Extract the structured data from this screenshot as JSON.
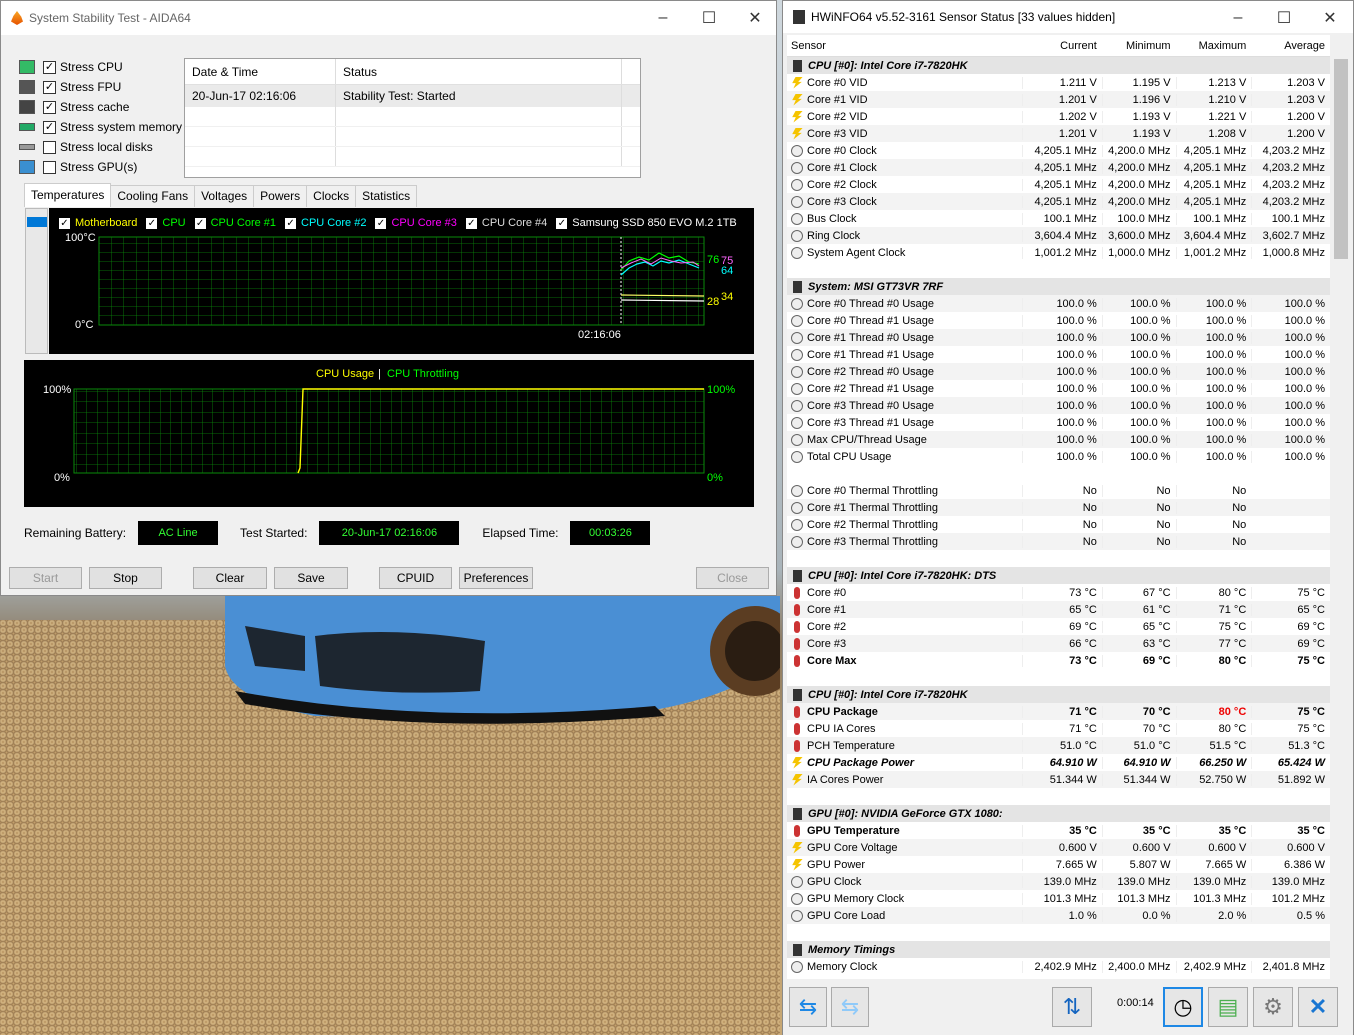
{
  "aida": {
    "title": "System Stability Test - AIDA64",
    "stress": [
      {
        "label": "Stress CPU",
        "checked": true,
        "icon": "cpu-chip-icon"
      },
      {
        "label": "Stress FPU",
        "checked": true,
        "icon": "fpu-icon"
      },
      {
        "label": "Stress cache",
        "checked": true,
        "icon": "cache-icon"
      },
      {
        "label": "Stress system memory",
        "checked": true,
        "icon": "memory-icon"
      },
      {
        "label": "Stress local disks",
        "checked": false,
        "icon": "disk-icon"
      },
      {
        "label": "Stress GPU(s)",
        "checked": false,
        "icon": "monitor-icon"
      }
    ],
    "log": {
      "col1": "Date & Time",
      "col2": "Status",
      "rows": [
        {
          "time": "20-Jun-17 02:16:06",
          "status": "Stability Test: Started"
        }
      ]
    },
    "tabs": [
      "Temperatures",
      "Cooling Fans",
      "Voltages",
      "Powers",
      "Clocks",
      "Statistics"
    ],
    "temp_legend": [
      {
        "label": "Motherboard",
        "color": "#ffff00"
      },
      {
        "label": "CPU",
        "color": "#00ff00"
      },
      {
        "label": "CPU Core #1",
        "color": "#00ff00"
      },
      {
        "label": "CPU Core #2",
        "color": "#00ffff"
      },
      {
        "label": "CPU Core #3",
        "color": "#ff00ff"
      },
      {
        "label": "CPU Core #4",
        "color": "#dddddd"
      },
      {
        "label": "Samsung SSD 850 EVO M.2 1TB",
        "color": "#ffffff"
      }
    ],
    "temp_graph": {
      "ymax": "100°C",
      "ymin": "0°C",
      "time": "02:16:06",
      "v76": "76",
      "v75": "75",
      "v64": "64",
      "v34": "34",
      "v28": "28"
    },
    "usage_graph": {
      "title_usage": "CPU Usage",
      "sep": "|",
      "title_throttle": "CPU Throttling",
      "left_top": "100%",
      "left_bottom": "0%",
      "right_top": "100%",
      "right_bottom": "0%"
    },
    "status": {
      "battery_label": "Remaining Battery:",
      "battery": "AC Line",
      "started_label": "Test Started:",
      "started": "20-Jun-17 02:16:06",
      "elapsed_label": "Elapsed Time:",
      "elapsed": "00:03:26"
    },
    "buttons": {
      "start": "Start",
      "stop": "Stop",
      "clear": "Clear",
      "save": "Save",
      "cpuid": "CPUID",
      "preferences": "Preferences",
      "close": "Close"
    }
  },
  "hwinfo": {
    "title": "HWiNFO64 v5.52-3161 Sensor Status [33 values hidden]",
    "columns": [
      "Sensor",
      "Current",
      "Minimum",
      "Maximum",
      "Average"
    ],
    "rows": [
      {
        "t": "sec",
        "n": "CPU [#0]: Intel Core i7-7820HK"
      },
      {
        "i": "volt",
        "n": "Core #0 VID",
        "v": [
          "1.211 V",
          "1.195 V",
          "1.213 V",
          "1.203 V"
        ]
      },
      {
        "i": "volt",
        "n": "Core #1 VID",
        "v": [
          "1.201 V",
          "1.196 V",
          "1.210 V",
          "1.203 V"
        ]
      },
      {
        "i": "volt",
        "n": "Core #2 VID",
        "v": [
          "1.202 V",
          "1.193 V",
          "1.221 V",
          "1.200 V"
        ]
      },
      {
        "i": "volt",
        "n": "Core #3 VID",
        "v": [
          "1.201 V",
          "1.193 V",
          "1.208 V",
          "1.200 V"
        ]
      },
      {
        "i": "clk",
        "n": "Core #0 Clock",
        "v": [
          "4,205.1 MHz",
          "4,200.0 MHz",
          "4,205.1 MHz",
          "4,203.2 MHz"
        ]
      },
      {
        "i": "clk",
        "n": "Core #1 Clock",
        "v": [
          "4,205.1 MHz",
          "4,200.0 MHz",
          "4,205.1 MHz",
          "4,203.2 MHz"
        ]
      },
      {
        "i": "clk",
        "n": "Core #2 Clock",
        "v": [
          "4,205.1 MHz",
          "4,200.0 MHz",
          "4,205.1 MHz",
          "4,203.2 MHz"
        ]
      },
      {
        "i": "clk",
        "n": "Core #3 Clock",
        "v": [
          "4,205.1 MHz",
          "4,200.0 MHz",
          "4,205.1 MHz",
          "4,203.2 MHz"
        ]
      },
      {
        "i": "clk",
        "n": "Bus Clock",
        "v": [
          "100.1 MHz",
          "100.0 MHz",
          "100.1 MHz",
          "100.1 MHz"
        ]
      },
      {
        "i": "clk",
        "n": "Ring Clock",
        "v": [
          "3,604.4 MHz",
          "3,600.0 MHz",
          "3,604.4 MHz",
          "3,602.7 MHz"
        ]
      },
      {
        "i": "clk",
        "n": "System Agent Clock",
        "v": [
          "1,001.2 MHz",
          "1,000.0 MHz",
          "1,001.2 MHz",
          "1,000.8 MHz"
        ]
      },
      {
        "t": "blank"
      },
      {
        "t": "sec",
        "n": "System: MSI GT73VR 7RF"
      },
      {
        "i": "clk",
        "n": "Core #0 Thread #0 Usage",
        "v": [
          "100.0 %",
          "100.0 %",
          "100.0 %",
          "100.0 %"
        ]
      },
      {
        "i": "clk",
        "n": "Core #0 Thread #1 Usage",
        "v": [
          "100.0 %",
          "100.0 %",
          "100.0 %",
          "100.0 %"
        ]
      },
      {
        "i": "clk",
        "n": "Core #1 Thread #0 Usage",
        "v": [
          "100.0 %",
          "100.0 %",
          "100.0 %",
          "100.0 %"
        ]
      },
      {
        "i": "clk",
        "n": "Core #1 Thread #1 Usage",
        "v": [
          "100.0 %",
          "100.0 %",
          "100.0 %",
          "100.0 %"
        ]
      },
      {
        "i": "clk",
        "n": "Core #2 Thread #0 Usage",
        "v": [
          "100.0 %",
          "100.0 %",
          "100.0 %",
          "100.0 %"
        ]
      },
      {
        "i": "clk",
        "n": "Core #2 Thread #1 Usage",
        "v": [
          "100.0 %",
          "100.0 %",
          "100.0 %",
          "100.0 %"
        ]
      },
      {
        "i": "clk",
        "n": "Core #3 Thread #0 Usage",
        "v": [
          "100.0 %",
          "100.0 %",
          "100.0 %",
          "100.0 %"
        ]
      },
      {
        "i": "clk",
        "n": "Core #3 Thread #1 Usage",
        "v": [
          "100.0 %",
          "100.0 %",
          "100.0 %",
          "100.0 %"
        ]
      },
      {
        "i": "clk",
        "n": "Max CPU/Thread Usage",
        "v": [
          "100.0 %",
          "100.0 %",
          "100.0 %",
          "100.0 %"
        ]
      },
      {
        "i": "clk",
        "n": "Total CPU Usage",
        "v": [
          "100.0 %",
          "100.0 %",
          "100.0 %",
          "100.0 %"
        ]
      },
      {
        "t": "blank"
      },
      {
        "i": "clk",
        "n": "Core #0 Thermal Throttling",
        "v": [
          "No",
          "No",
          "No",
          ""
        ]
      },
      {
        "i": "clk",
        "n": "Core #1 Thermal Throttling",
        "v": [
          "No",
          "No",
          "No",
          ""
        ]
      },
      {
        "i": "clk",
        "n": "Core #2 Thermal Throttling",
        "v": [
          "No",
          "No",
          "No",
          ""
        ]
      },
      {
        "i": "clk",
        "n": "Core #3 Thermal Throttling",
        "v": [
          "No",
          "No",
          "No",
          ""
        ]
      },
      {
        "t": "blank"
      },
      {
        "t": "sec",
        "n": "CPU [#0]: Intel Core i7-7820HK: DTS"
      },
      {
        "i": "therm",
        "n": "Core #0",
        "v": [
          "73 °C",
          "67 °C",
          "80 °C",
          "75 °C"
        ]
      },
      {
        "i": "therm",
        "n": "Core #1",
        "v": [
          "65 °C",
          "61 °C",
          "71 °C",
          "65 °C"
        ]
      },
      {
        "i": "therm",
        "n": "Core #2",
        "v": [
          "69 °C",
          "65 °C",
          "75 °C",
          "69 °C"
        ]
      },
      {
        "i": "therm",
        "n": "Core #3",
        "v": [
          "66 °C",
          "63 °C",
          "77 °C",
          "69 °C"
        ]
      },
      {
        "i": "therm",
        "n": "Core Max",
        "v": [
          "73 °C",
          "69 °C",
          "80 °C",
          "75 °C"
        ],
        "s": "bold"
      },
      {
        "t": "blank"
      },
      {
        "t": "sec",
        "n": "CPU [#0]: Intel Core i7-7820HK"
      },
      {
        "i": "therm",
        "n": "CPU Package",
        "v": [
          "71 °C",
          "70 °C",
          "80 °C",
          "75 °C"
        ],
        "s": "bold",
        "red": 2
      },
      {
        "i": "therm",
        "n": "CPU IA Cores",
        "v": [
          "71 °C",
          "70 °C",
          "80 °C",
          "75 °C"
        ]
      },
      {
        "i": "therm",
        "n": "PCH Temperature",
        "v": [
          "51.0 °C",
          "51.0 °C",
          "51.5 °C",
          "51.3 °C"
        ]
      },
      {
        "i": "volt",
        "n": "CPU Package Power",
        "v": [
          "64.910 W",
          "64.910 W",
          "66.250 W",
          "65.424 W"
        ],
        "s": "it"
      },
      {
        "i": "volt",
        "n": "IA Cores Power",
        "v": [
          "51.344 W",
          "51.344 W",
          "52.750 W",
          "51.892 W"
        ]
      },
      {
        "t": "blank"
      },
      {
        "t": "sec",
        "n": "GPU [#0]: NVIDIA GeForce GTX 1080:"
      },
      {
        "i": "therm",
        "n": "GPU Temperature",
        "v": [
          "35 °C",
          "35 °C",
          "35 °C",
          "35 °C"
        ],
        "s": "bold"
      },
      {
        "i": "volt",
        "n": "GPU Core Voltage",
        "v": [
          "0.600 V",
          "0.600 V",
          "0.600 V",
          "0.600 V"
        ]
      },
      {
        "i": "volt",
        "n": "GPU Power",
        "v": [
          "7.665 W",
          "5.807 W",
          "7.665 W",
          "6.386 W"
        ]
      },
      {
        "i": "clk",
        "n": "GPU Clock",
        "v": [
          "139.0 MHz",
          "139.0 MHz",
          "139.0 MHz",
          "139.0 MHz"
        ]
      },
      {
        "i": "clk",
        "n": "GPU Memory Clock",
        "v": [
          "101.3 MHz",
          "101.3 MHz",
          "101.3 MHz",
          "101.2 MHz"
        ]
      },
      {
        "i": "clk",
        "n": "GPU Core Load",
        "v": [
          "1.0 %",
          "0.0 %",
          "2.0 %",
          "0.5 %"
        ]
      },
      {
        "t": "blank"
      },
      {
        "t": "sec",
        "n": "Memory Timings"
      },
      {
        "i": "clk",
        "n": "Memory Clock",
        "v": [
          "2,402.9 MHz",
          "2,400.0 MHz",
          "2,402.9 MHz",
          "2,401.8 MHz"
        ]
      }
    ],
    "timer": "0:00:14",
    "colors": {
      "accent": "#0078d7",
      "red": "#e00000"
    }
  }
}
